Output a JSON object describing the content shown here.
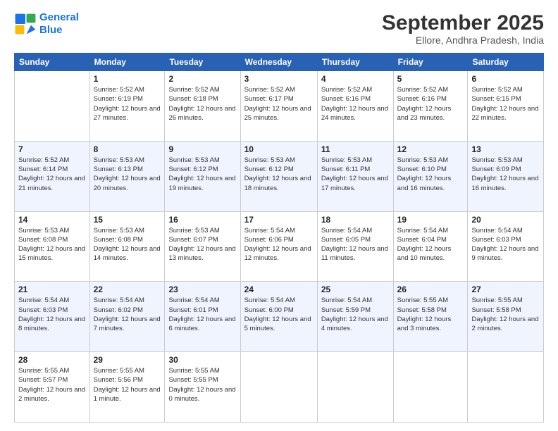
{
  "header": {
    "logo_line1": "General",
    "logo_line2": "Blue",
    "month": "September 2025",
    "location": "Ellore, Andhra Pradesh, India"
  },
  "days_of_week": [
    "Sunday",
    "Monday",
    "Tuesday",
    "Wednesday",
    "Thursday",
    "Friday",
    "Saturday"
  ],
  "weeks": [
    [
      {
        "day": "",
        "sunrise": "",
        "sunset": "",
        "daylight": ""
      },
      {
        "day": "1",
        "sunrise": "Sunrise: 5:52 AM",
        "sunset": "Sunset: 6:19 PM",
        "daylight": "Daylight: 12 hours and 27 minutes."
      },
      {
        "day": "2",
        "sunrise": "Sunrise: 5:52 AM",
        "sunset": "Sunset: 6:18 PM",
        "daylight": "Daylight: 12 hours and 26 minutes."
      },
      {
        "day": "3",
        "sunrise": "Sunrise: 5:52 AM",
        "sunset": "Sunset: 6:17 PM",
        "daylight": "Daylight: 12 hours and 25 minutes."
      },
      {
        "day": "4",
        "sunrise": "Sunrise: 5:52 AM",
        "sunset": "Sunset: 6:16 PM",
        "daylight": "Daylight: 12 hours and 24 minutes."
      },
      {
        "day": "5",
        "sunrise": "Sunrise: 5:52 AM",
        "sunset": "Sunset: 6:16 PM",
        "daylight": "Daylight: 12 hours and 23 minutes."
      },
      {
        "day": "6",
        "sunrise": "Sunrise: 5:52 AM",
        "sunset": "Sunset: 6:15 PM",
        "daylight": "Daylight: 12 hours and 22 minutes."
      }
    ],
    [
      {
        "day": "7",
        "sunrise": "Sunrise: 5:52 AM",
        "sunset": "Sunset: 6:14 PM",
        "daylight": "Daylight: 12 hours and 21 minutes."
      },
      {
        "day": "8",
        "sunrise": "Sunrise: 5:53 AM",
        "sunset": "Sunset: 6:13 PM",
        "daylight": "Daylight: 12 hours and 20 minutes."
      },
      {
        "day": "9",
        "sunrise": "Sunrise: 5:53 AM",
        "sunset": "Sunset: 6:12 PM",
        "daylight": "Daylight: 12 hours and 19 minutes."
      },
      {
        "day": "10",
        "sunrise": "Sunrise: 5:53 AM",
        "sunset": "Sunset: 6:12 PM",
        "daylight": "Daylight: 12 hours and 18 minutes."
      },
      {
        "day": "11",
        "sunrise": "Sunrise: 5:53 AM",
        "sunset": "Sunset: 6:11 PM",
        "daylight": "Daylight: 12 hours and 17 minutes."
      },
      {
        "day": "12",
        "sunrise": "Sunrise: 5:53 AM",
        "sunset": "Sunset: 6:10 PM",
        "daylight": "Daylight: 12 hours and 16 minutes."
      },
      {
        "day": "13",
        "sunrise": "Sunrise: 5:53 AM",
        "sunset": "Sunset: 6:09 PM",
        "daylight": "Daylight: 12 hours and 16 minutes."
      }
    ],
    [
      {
        "day": "14",
        "sunrise": "Sunrise: 5:53 AM",
        "sunset": "Sunset: 6:08 PM",
        "daylight": "Daylight: 12 hours and 15 minutes."
      },
      {
        "day": "15",
        "sunrise": "Sunrise: 5:53 AM",
        "sunset": "Sunset: 6:08 PM",
        "daylight": "Daylight: 12 hours and 14 minutes."
      },
      {
        "day": "16",
        "sunrise": "Sunrise: 5:53 AM",
        "sunset": "Sunset: 6:07 PM",
        "daylight": "Daylight: 12 hours and 13 minutes."
      },
      {
        "day": "17",
        "sunrise": "Sunrise: 5:54 AM",
        "sunset": "Sunset: 6:06 PM",
        "daylight": "Daylight: 12 hours and 12 minutes."
      },
      {
        "day": "18",
        "sunrise": "Sunrise: 5:54 AM",
        "sunset": "Sunset: 6:05 PM",
        "daylight": "Daylight: 12 hours and 11 minutes."
      },
      {
        "day": "19",
        "sunrise": "Sunrise: 5:54 AM",
        "sunset": "Sunset: 6:04 PM",
        "daylight": "Daylight: 12 hours and 10 minutes."
      },
      {
        "day": "20",
        "sunrise": "Sunrise: 5:54 AM",
        "sunset": "Sunset: 6:03 PM",
        "daylight": "Daylight: 12 hours and 9 minutes."
      }
    ],
    [
      {
        "day": "21",
        "sunrise": "Sunrise: 5:54 AM",
        "sunset": "Sunset: 6:03 PM",
        "daylight": "Daylight: 12 hours and 8 minutes."
      },
      {
        "day": "22",
        "sunrise": "Sunrise: 5:54 AM",
        "sunset": "Sunset: 6:02 PM",
        "daylight": "Daylight: 12 hours and 7 minutes."
      },
      {
        "day": "23",
        "sunrise": "Sunrise: 5:54 AM",
        "sunset": "Sunset: 6:01 PM",
        "daylight": "Daylight: 12 hours and 6 minutes."
      },
      {
        "day": "24",
        "sunrise": "Sunrise: 5:54 AM",
        "sunset": "Sunset: 6:00 PM",
        "daylight": "Daylight: 12 hours and 5 minutes."
      },
      {
        "day": "25",
        "sunrise": "Sunrise: 5:54 AM",
        "sunset": "Sunset: 5:59 PM",
        "daylight": "Daylight: 12 hours and 4 minutes."
      },
      {
        "day": "26",
        "sunrise": "Sunrise: 5:55 AM",
        "sunset": "Sunset: 5:58 PM",
        "daylight": "Daylight: 12 hours and 3 minutes."
      },
      {
        "day": "27",
        "sunrise": "Sunrise: 5:55 AM",
        "sunset": "Sunset: 5:58 PM",
        "daylight": "Daylight: 12 hours and 2 minutes."
      }
    ],
    [
      {
        "day": "28",
        "sunrise": "Sunrise: 5:55 AM",
        "sunset": "Sunset: 5:57 PM",
        "daylight": "Daylight: 12 hours and 2 minutes."
      },
      {
        "day": "29",
        "sunrise": "Sunrise: 5:55 AM",
        "sunset": "Sunset: 5:56 PM",
        "daylight": "Daylight: 12 hours and 1 minute."
      },
      {
        "day": "30",
        "sunrise": "Sunrise: 5:55 AM",
        "sunset": "Sunset: 5:55 PM",
        "daylight": "Daylight: 12 hours and 0 minutes."
      },
      {
        "day": "",
        "sunrise": "",
        "sunset": "",
        "daylight": ""
      },
      {
        "day": "",
        "sunrise": "",
        "sunset": "",
        "daylight": ""
      },
      {
        "day": "",
        "sunrise": "",
        "sunset": "",
        "daylight": ""
      },
      {
        "day": "",
        "sunrise": "",
        "sunset": "",
        "daylight": ""
      }
    ]
  ]
}
